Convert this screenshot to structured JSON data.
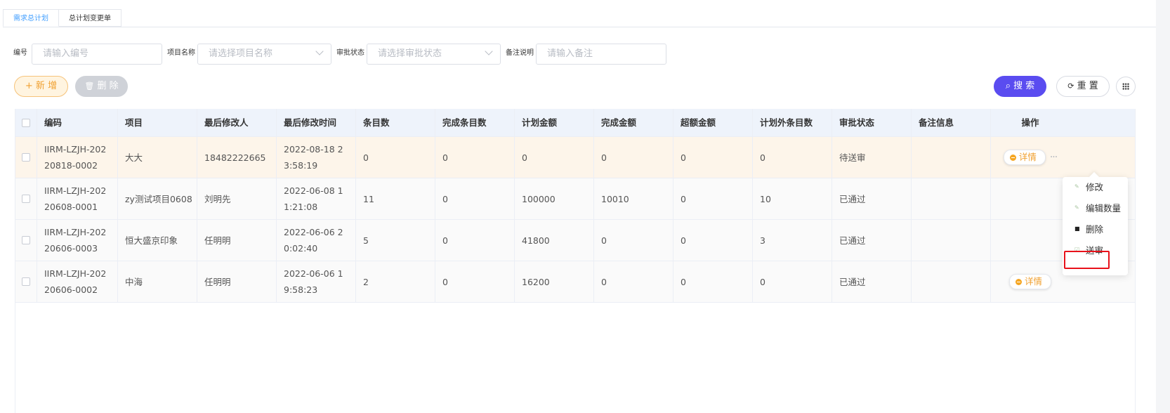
{
  "tabs": [
    "需求总计划",
    "总计划变更单"
  ],
  "filters": {
    "code": {
      "label": "编号",
      "placeholder": "请输入编号"
    },
    "project": {
      "label": "项目名称",
      "placeholder": "请选择项目名称"
    },
    "status": {
      "label": "审批状态",
      "placeholder": "请选择审批状态"
    },
    "remark": {
      "label": "备注说明",
      "placeholder": "请输入备注"
    }
  },
  "toolbar": {
    "add": "+ 新 增",
    "delete": "删 除",
    "search": "搜 索",
    "reset": "重 置"
  },
  "table": {
    "headers": [
      "编码",
      "项目",
      "最后修改人",
      "最后修改时间",
      "条目数",
      "完成条目数",
      "计划金额",
      "完成金额",
      "超额金额",
      "计划外条目数",
      "审批状态",
      "备注信息",
      "操作"
    ],
    "rows": [
      [
        "IIRM-LZJH-20220818-0002",
        "大大",
        "18482222665",
        "2022-08-18 23:58:19",
        "0",
        "0",
        "0",
        "0",
        "0",
        "0",
        "待送审",
        ""
      ],
      [
        "IIRM-LZJH-20220608-0001",
        "zy测试项目0608",
        "刘明先",
        "2022-06-08 11:21:08",
        "11",
        "0",
        "100000",
        "10010",
        "0",
        "10",
        "已通过",
        ""
      ],
      [
        "IIRM-LZJH-20220606-0003",
        "恒大盛京印象",
        "任明明",
        "2022-06-06 20:02:40",
        "5",
        "0",
        "41800",
        "0",
        "0",
        "3",
        "已通过",
        ""
      ],
      [
        "IIRM-LZJH-20220606-0002",
        "中海",
        "任明明",
        "2022-06-06 19:58:23",
        "2",
        "0",
        "16200",
        "0",
        "0",
        "0",
        "已通过",
        ""
      ]
    ],
    "detail_label": "详情"
  },
  "dropdown": [
    "修改",
    "编辑数量",
    "删除",
    "送审"
  ],
  "colors": {
    "accent": "#5a4cf0",
    "orange": "#f0a030",
    "highlight_row": "#fdf5ea",
    "red_box": "#e8121b"
  }
}
